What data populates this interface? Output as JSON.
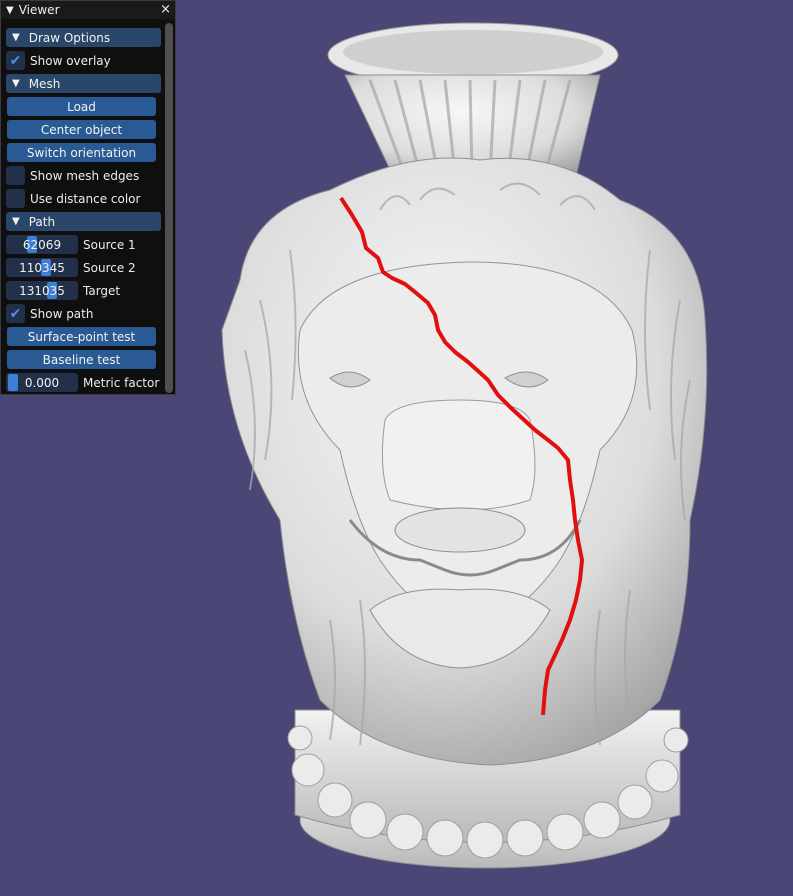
{
  "window": {
    "title": "Viewer",
    "close_glyph": "×"
  },
  "sections": {
    "draw_options": {
      "label": "Draw Options",
      "show_overlay": {
        "label": "Show overlay",
        "checked": true
      }
    },
    "mesh": {
      "label": "Mesh",
      "load_button": "Load",
      "center_button": "Center object",
      "switch_button": "Switch orientation",
      "show_edges": {
        "label": "Show mesh edges",
        "checked": false
      },
      "distance_color": {
        "label": "Use distance color",
        "checked": false
      }
    },
    "path": {
      "label": "Path",
      "source1": {
        "value": "62069",
        "label": "Source 1"
      },
      "source2": {
        "value": "110345",
        "label": "Source 2"
      },
      "target": {
        "value": "131035",
        "label": "Target"
      },
      "show_path": {
        "label": "Show path",
        "checked": true
      },
      "surface_test_button": "Surface-point test",
      "baseline_test_button": "Baseline test",
      "metric_factor": {
        "value": "0.000",
        "label": "Metric factor"
      }
    }
  },
  "icons": {
    "collapse": "triangle-down-icon",
    "check": "checkmark-icon"
  },
  "colors": {
    "background": "#4a4776",
    "panel": "#0f0f0f",
    "header": "#2a4669",
    "button": "#2a5a93",
    "frame": "#22304a",
    "accent": "#3d7fd6",
    "path": "#e01010",
    "mesh": "#e6e6e6"
  }
}
